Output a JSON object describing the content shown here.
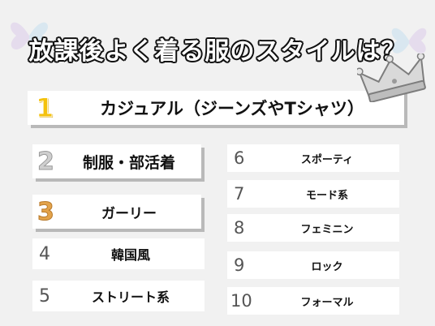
{
  "title": "放課後よく着る服のスタイルは？",
  "rankings": [
    {
      "rank": "1",
      "label": "カジュアル（ジーンズやTシャツ）"
    },
    {
      "rank": "2",
      "label": "制服・部活着"
    },
    {
      "rank": "3",
      "label": "ガーリー"
    },
    {
      "rank": "4",
      "label": "韓国風"
    },
    {
      "rank": "5",
      "label": "ストリート系"
    },
    {
      "rank": "6",
      "label": "スポーティ"
    },
    {
      "rank": "7",
      "label": "モード系"
    },
    {
      "rank": "8",
      "label": "フェミニン"
    },
    {
      "rank": "9",
      "label": "ロック"
    },
    {
      "rank": "10",
      "label": "フォーマル"
    }
  ],
  "colors": {
    "gold": "#f4c20d",
    "silver": "#cfcfcf",
    "bronze": "#e3a34b",
    "background": "#f1f1f1"
  }
}
